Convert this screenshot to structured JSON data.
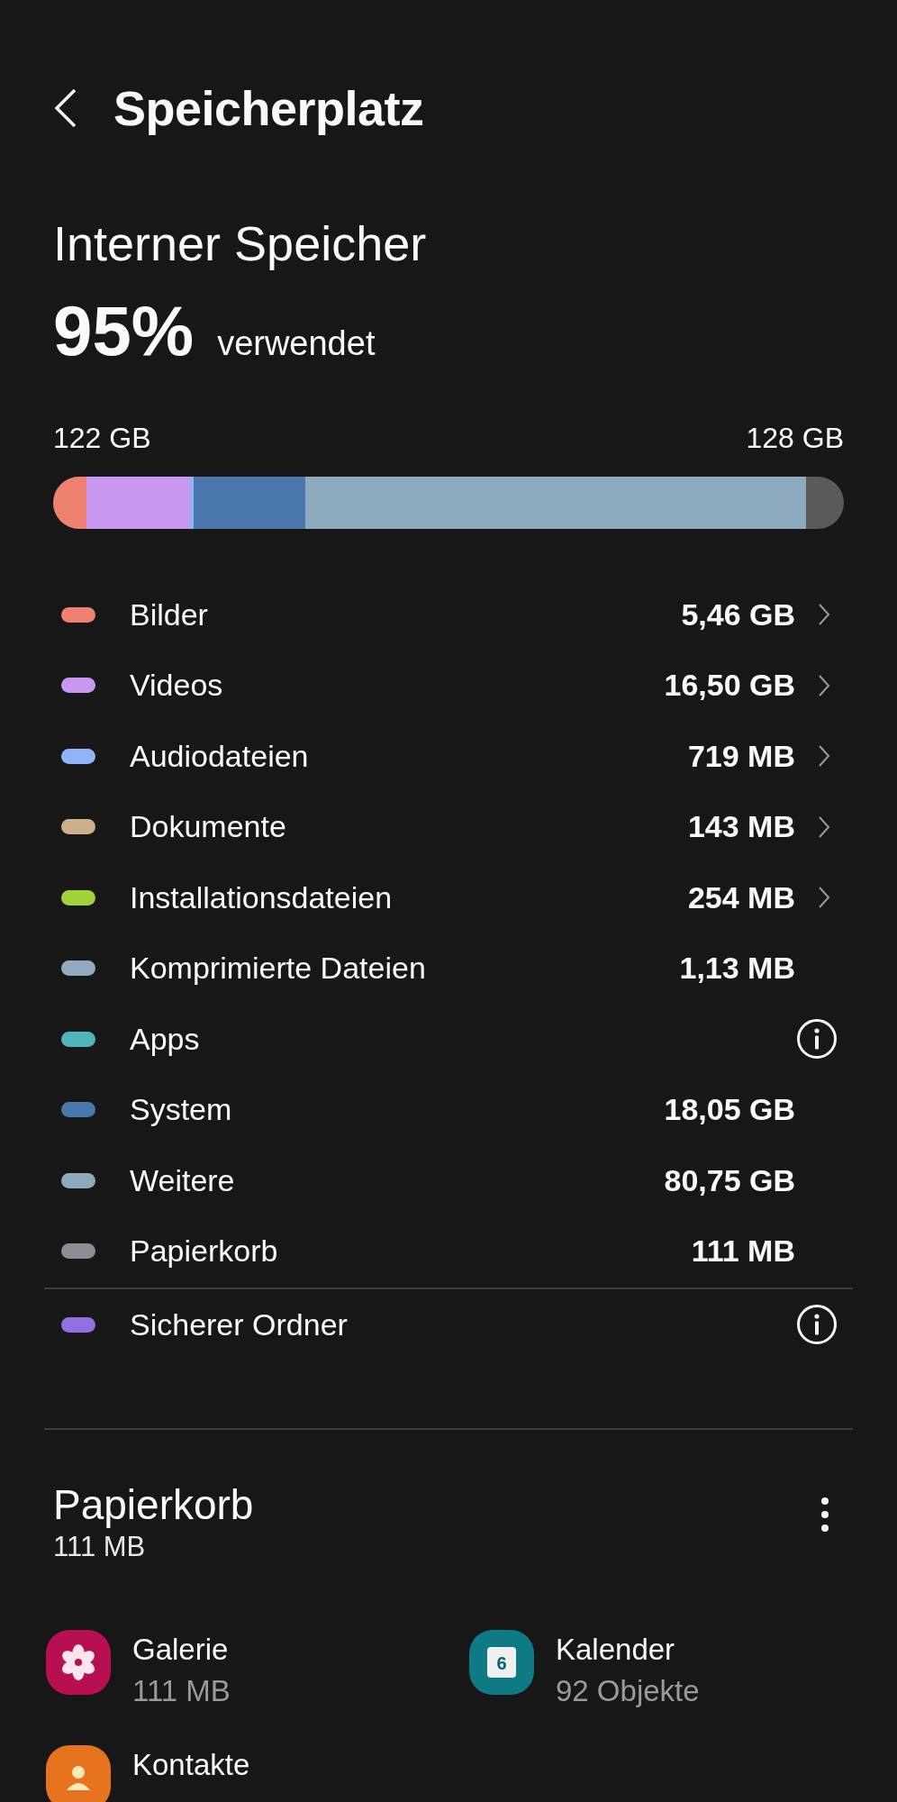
{
  "header": {
    "title": "Speicherplatz"
  },
  "storage": {
    "title": "Interner Speicher",
    "percent": "95%",
    "percent_label": "verwendet",
    "used": "122 GB",
    "total": "128 GB",
    "bar": [
      {
        "color": "#f08070"
      },
      {
        "color": "#c996f0"
      },
      {
        "color": "#8fb4f8"
      },
      {
        "color": "#4a77ad"
      },
      {
        "color": "#8eaabd"
      }
    ]
  },
  "categories": [
    {
      "label": "Bilder",
      "value": "5,46 GB",
      "color": "#f08070",
      "kind": "link"
    },
    {
      "label": "Videos",
      "value": "16,50 GB",
      "color": "#c996f0",
      "kind": "link"
    },
    {
      "label": "Audiodateien",
      "value": "719 MB",
      "color": "#8fb4f8",
      "kind": "link"
    },
    {
      "label": "Dokumente",
      "value": "143 MB",
      "color": "#cdb08a",
      "kind": "link"
    },
    {
      "label": "Installationsdateien",
      "value": "254 MB",
      "color": "#9ed43a",
      "kind": "link"
    },
    {
      "label": "Komprimierte Dateien",
      "value": "1,13 MB",
      "color": "#91aac0",
      "kind": "plain"
    },
    {
      "label": "Apps",
      "color": "#4fb5b8",
      "kind": "info"
    },
    {
      "label": "System",
      "value": "18,05 GB",
      "color": "#4a77ad",
      "kind": "plain"
    },
    {
      "label": "Weitere",
      "value": "80,75 GB",
      "color": "#8eaabd",
      "kind": "plain"
    },
    {
      "label": "Papierkorb",
      "value": "111 MB",
      "color": "#8d8d93",
      "kind": "plain"
    },
    {
      "label": "Sicherer Ordner",
      "color": "#9370e0",
      "kind": "info",
      "separated": true
    }
  ],
  "trash": {
    "title": "Papierkorb",
    "size": "111 MB",
    "items": [
      {
        "name": "Galerie",
        "detail": "111 MB",
        "kind": "gallery"
      },
      {
        "name": "Kalender",
        "detail": "92 Objekte",
        "kind": "calendar",
        "badge": "6"
      },
      {
        "name": "Kontakte",
        "kind": "contacts"
      }
    ]
  }
}
